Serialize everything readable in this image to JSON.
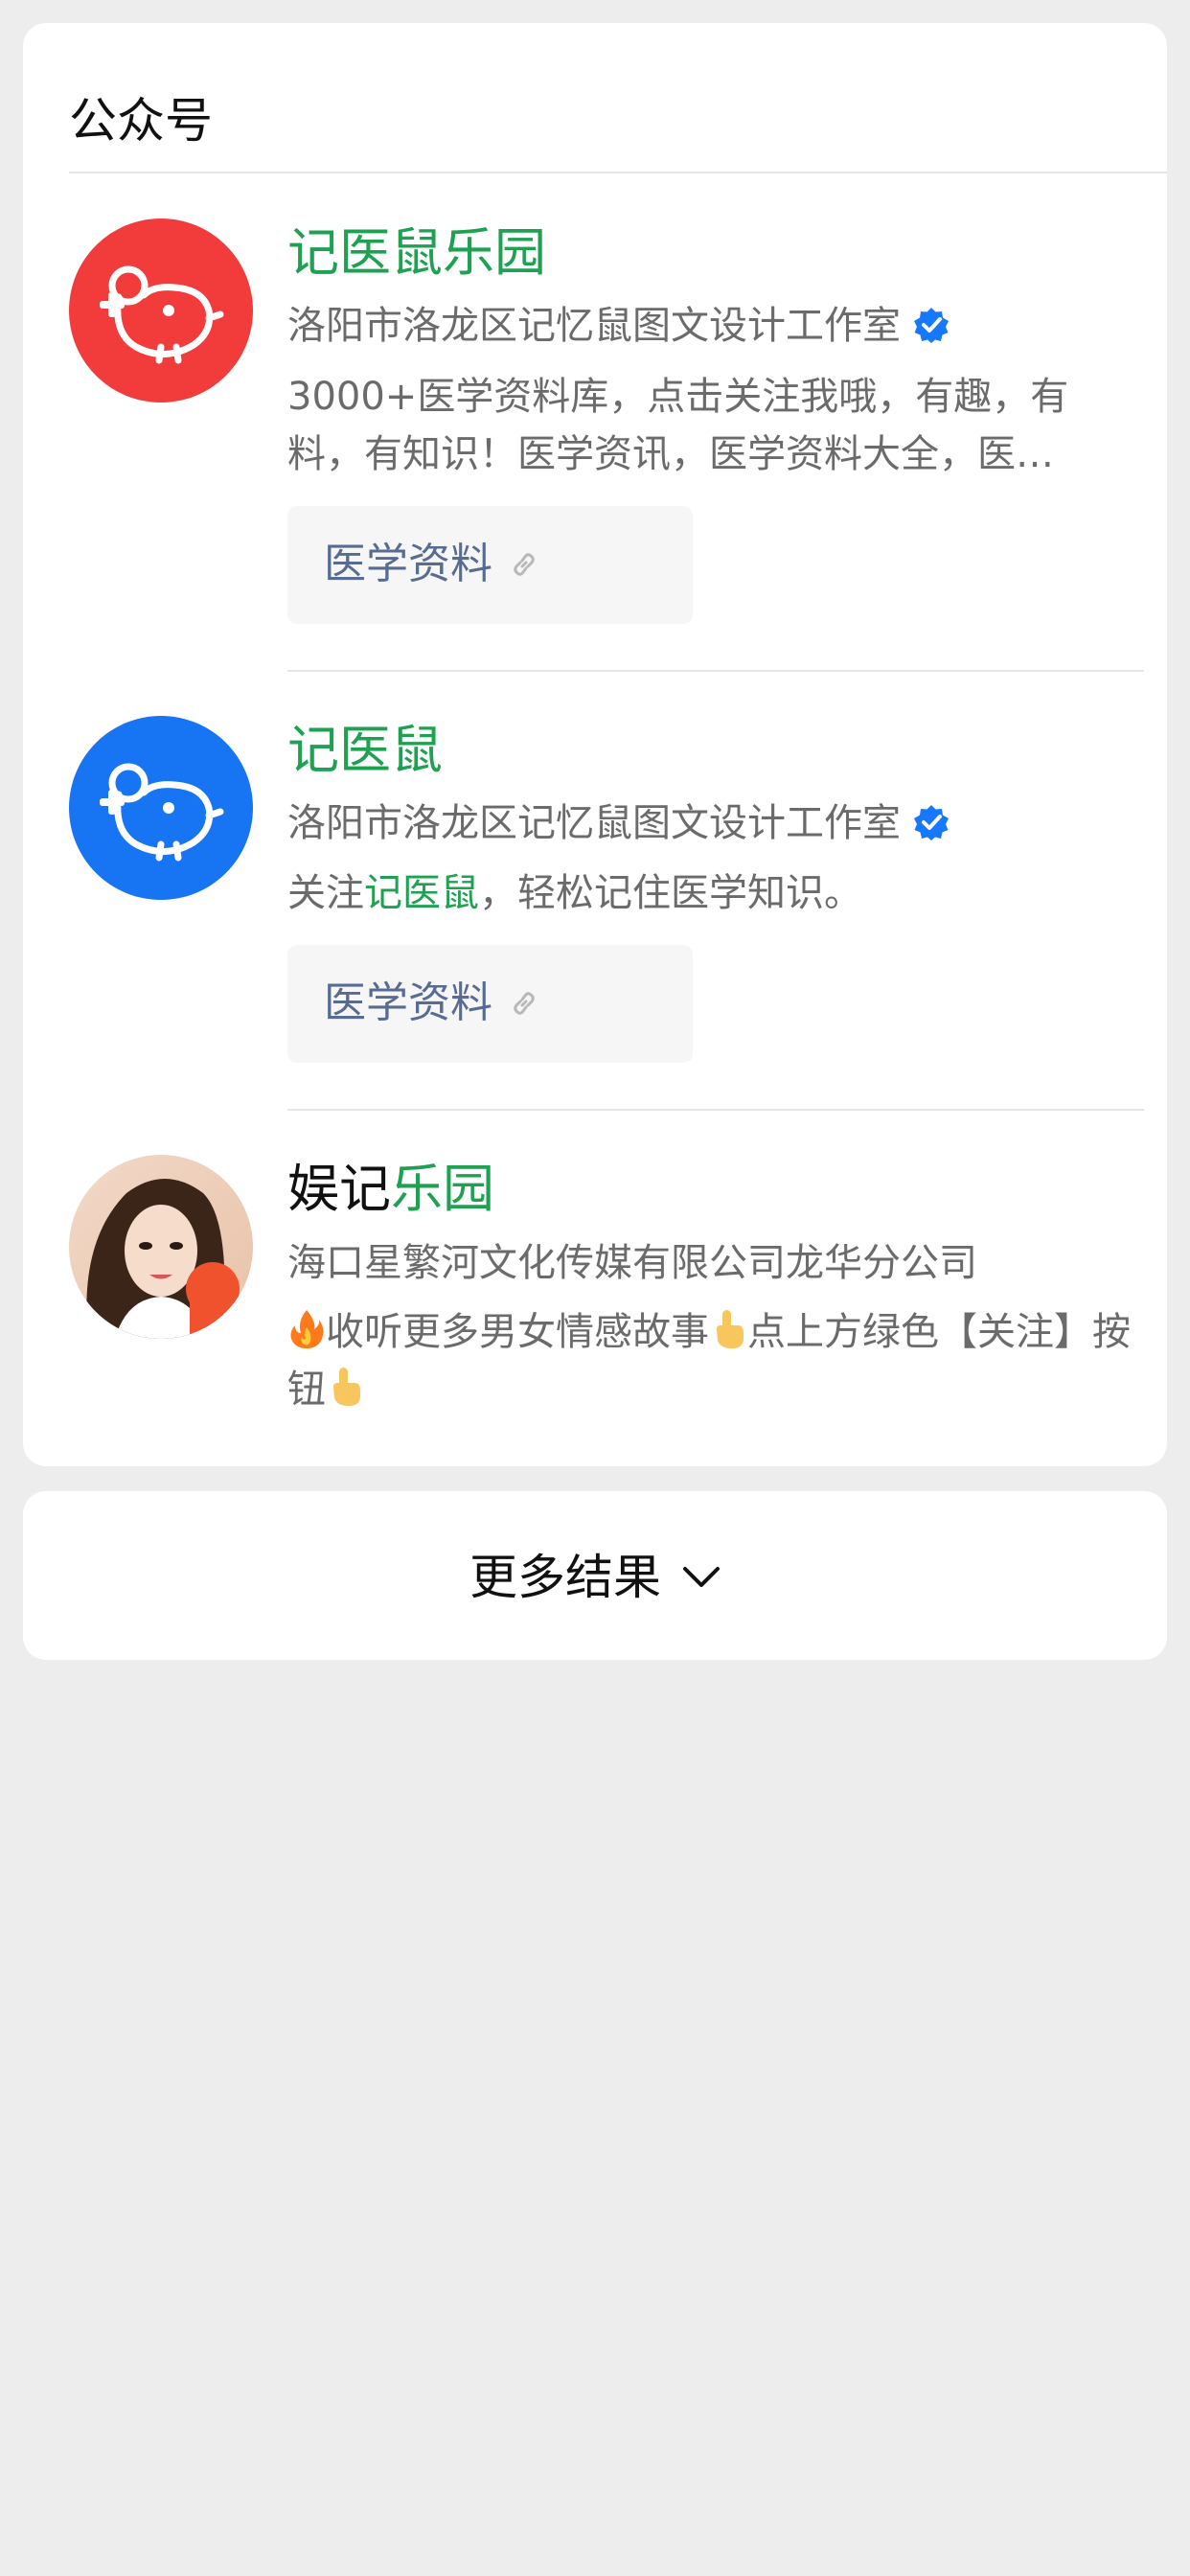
{
  "section": {
    "title": "公众号"
  },
  "accounts": [
    {
      "name_part1": "记医鼠乐园",
      "name_part2": "",
      "org": "洛阳市洛龙区记忆鼠图文设计工作室",
      "verified": true,
      "desc": "3000+医学资料库，点击关注我哦，有趣，有料，有知识！医学资讯，医学资料大全，医…",
      "link_label": "医学资料",
      "avatar_color": "#f23b3b",
      "avatar_icon": "mouse-logo-icon"
    },
    {
      "name_part1": "记医鼠",
      "org": "洛阳市洛龙区记忆鼠图文设计工作室",
      "verified": true,
      "desc_prefix": "关注",
      "desc_highlight": "记医鼠",
      "desc_suffix": "，轻松记住医学知识。",
      "link_label": "医学资料",
      "avatar_color": "#1774f2",
      "avatar_icon": "mouse-logo-icon"
    },
    {
      "name_part1": "娱记",
      "name_part2": "乐园",
      "org": "海口星繁河文化传媒有限公司龙华分公司",
      "verified": false,
      "desc_part1": "收听更多男女情感故事",
      "desc_part2": "点上方绿色【关注】按钮",
      "avatar_icon": "profile-photo"
    }
  ],
  "more_results": {
    "label": "更多结果"
  },
  "colors": {
    "accent_green": "#1fa152",
    "link_blue": "#586c93",
    "verify_blue": "#1677ff"
  }
}
